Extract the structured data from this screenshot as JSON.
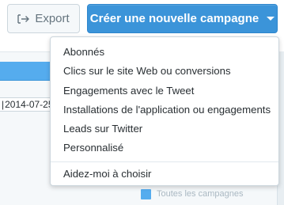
{
  "toolbar": {
    "export_label": "Export",
    "create_label": "Créer une nouvelle campagne"
  },
  "background": {
    "date_text": "2014-07-25",
    "legend_label": "Toutes les campagnes"
  },
  "menu": {
    "items": [
      "Abonnés",
      "Clics sur le site Web ou conversions",
      "Engagements avec le Tweet",
      "Installations de l'application ou engagements",
      "Leads sur Twitter",
      "Personnalisé"
    ],
    "help_label": "Aidez-moi à choisir"
  },
  "colors": {
    "primary_button": "#3b94d9",
    "accent_blue": "#55acee",
    "menu_text": "#292f33"
  },
  "icons": {
    "export": "export-arrow-icon",
    "dropdown": "caret-down-icon"
  }
}
